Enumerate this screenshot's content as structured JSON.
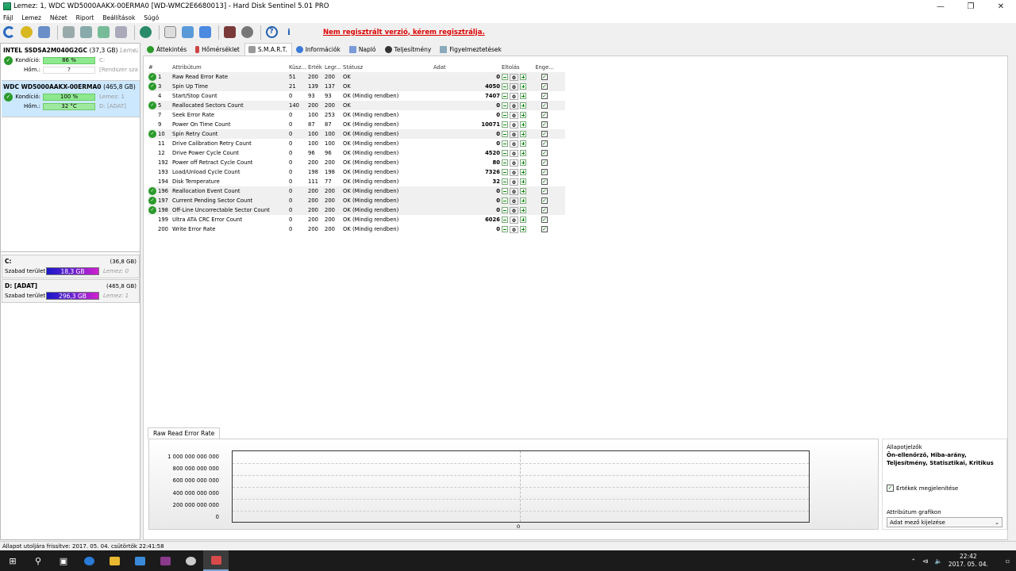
{
  "window": {
    "title": "Lemez: 1, WDC WD5000AAKX-00ERMA0 [WD-WMC2E6680013]  -  Hard Disk Sentinel 5.01 PRO"
  },
  "menu": [
    "Fájl",
    "Lemez",
    "Nézet",
    "Riport",
    "Beállítások",
    "Súgó"
  ],
  "toolbar": {
    "register_msg": "Nem regisztrált verzió, kérem regisztrálja."
  },
  "disks": [
    {
      "name": "INTEL SSDSA2M040G2GC",
      "capacity": "(37,3 GB)",
      "lemez": "Lemez:",
      "cond_label": "Kondíció:",
      "cond": "86 %",
      "cond_pct": 86,
      "cond_extra": "C:",
      "temp_label": "Hőm.:",
      "temp": "?",
      "temp_extra": "[Rendszer sza"
    },
    {
      "name": "WDC WD5000AAKX-00ERMA0",
      "capacity": "(465,8 GB)",
      "lemez": "",
      "cond_label": "Kondíció:",
      "cond": "100 %",
      "cond_pct": 100,
      "cond_extra": "Lemez: 1",
      "temp_label": "Hőm.:",
      "temp": "32 °C",
      "temp_extra": "D: [ADAT]"
    }
  ],
  "volumes": [
    {
      "name": "C:",
      "size": "(36,8 GB)",
      "free_label": "Szabad terület",
      "free": "18,3 GB",
      "lemez": "Lemez: 0"
    },
    {
      "name": "D: [ADAT]",
      "size": "(465,8 GB)",
      "free_label": "Szabad terület",
      "free": "296,3 GB",
      "lemez": "Lemez: 1"
    }
  ],
  "tabs": [
    "Áttekintés",
    "Hőmérséklet",
    "S.M.A.R.T.",
    "Információk",
    "Napló",
    "Teljesítmény",
    "Figyelmeztetések"
  ],
  "smart": {
    "headers": {
      "num": "#",
      "attr": "Attribútum",
      "thr": "Küsz...",
      "val": "Érték",
      "worst": "Legr...",
      "status": "Státusz",
      "data": "Adat",
      "offset": "Eltolás",
      "enable": "Enge..."
    },
    "rows": [
      {
        "id": "1",
        "name": "Raw Read Error Rate",
        "thr": "51",
        "val": "200",
        "worst": "200",
        "status": "OK",
        "data": "0",
        "off": "0",
        "ok": true
      },
      {
        "id": "3",
        "name": "Spin Up Time",
        "thr": "21",
        "val": "139",
        "worst": "137",
        "status": "OK",
        "data": "4050",
        "off": "0",
        "ok": true
      },
      {
        "id": "4",
        "name": "Start/Stop Count",
        "thr": "0",
        "val": "93",
        "worst": "93",
        "status": "OK (Mindig rendben)",
        "data": "7407",
        "off": "0",
        "ok": false
      },
      {
        "id": "5",
        "name": "Reallocated Sectors Count",
        "thr": "140",
        "val": "200",
        "worst": "200",
        "status": "OK",
        "data": "0",
        "off": "0",
        "ok": true
      },
      {
        "id": "7",
        "name": "Seek Error Rate",
        "thr": "0",
        "val": "100",
        "worst": "253",
        "status": "OK (Mindig rendben)",
        "data": "0",
        "off": "0",
        "ok": false
      },
      {
        "id": "9",
        "name": "Power On Time Count",
        "thr": "0",
        "val": "87",
        "worst": "87",
        "status": "OK (Mindig rendben)",
        "data": "10071",
        "off": "0",
        "ok": false
      },
      {
        "id": "10",
        "name": "Spin Retry Count",
        "thr": "0",
        "val": "100",
        "worst": "100",
        "status": "OK (Mindig rendben)",
        "data": "0",
        "off": "0",
        "ok": true
      },
      {
        "id": "11",
        "name": "Drive Calibration Retry Count",
        "thr": "0",
        "val": "100",
        "worst": "100",
        "status": "OK (Mindig rendben)",
        "data": "0",
        "off": "0",
        "ok": false
      },
      {
        "id": "12",
        "name": "Drive Power Cycle Count",
        "thr": "0",
        "val": "96",
        "worst": "96",
        "status": "OK (Mindig rendben)",
        "data": "4520",
        "off": "0",
        "ok": false
      },
      {
        "id": "192",
        "name": "Power off Retract Cycle Count",
        "thr": "0",
        "val": "200",
        "worst": "200",
        "status": "OK (Mindig rendben)",
        "data": "80",
        "off": "0",
        "ok": false
      },
      {
        "id": "193",
        "name": "Load/Unload Cycle Count",
        "thr": "0",
        "val": "198",
        "worst": "198",
        "status": "OK (Mindig rendben)",
        "data": "7326",
        "off": "0",
        "ok": false
      },
      {
        "id": "194",
        "name": "Disk Temperature",
        "thr": "0",
        "val": "111",
        "worst": "77",
        "status": "OK (Mindig rendben)",
        "data": "32",
        "off": "0",
        "ok": false
      },
      {
        "id": "196",
        "name": "Reallocation Event Count",
        "thr": "0",
        "val": "200",
        "worst": "200",
        "status": "OK (Mindig rendben)",
        "data": "0",
        "off": "0",
        "ok": true
      },
      {
        "id": "197",
        "name": "Current Pending Sector Count",
        "thr": "0",
        "val": "200",
        "worst": "200",
        "status": "OK (Mindig rendben)",
        "data": "0",
        "off": "0",
        "ok": true
      },
      {
        "id": "198",
        "name": "Off-Line Uncorrectable Sector Count",
        "thr": "0",
        "val": "200",
        "worst": "200",
        "status": "OK (Mindig rendben)",
        "data": "0",
        "off": "0",
        "ok": true
      },
      {
        "id": "199",
        "name": "Ultra ATA CRC Error Count",
        "thr": "0",
        "val": "200",
        "worst": "200",
        "status": "OK (Mindig rendben)",
        "data": "6026",
        "off": "0",
        "ok": false
      },
      {
        "id": "200",
        "name": "Write Error Rate",
        "thr": "0",
        "val": "200",
        "worst": "200",
        "status": "OK (Mindig rendben)",
        "data": "0",
        "off": "0",
        "ok": false
      }
    ]
  },
  "graph": {
    "tab": "Raw Read Error Rate",
    "yticks": [
      "1 000 000 000 000",
      "800 000 000 000",
      "600 000 000 000",
      "400 000 000 000",
      "200 000 000 000",
      "0"
    ],
    "xlabel": "0"
  },
  "side": {
    "title": "Állapotjelzők",
    "bold": "Ön-ellenőrző, Hiba-arány, Teljesítmény, Statisztikai, Kritikus",
    "checkbox": "Értékek megjelenítése",
    "graph_label": "Attribútum grafikon",
    "graph_select": "Adat mező kijelzése"
  },
  "status": "Állapot utoljára frissítve: 2017. 05. 04. csütörtök 22:41:58",
  "clock": {
    "time": "22:42",
    "date": "2017. 05. 04."
  },
  "colors": {
    "ok_green": "#2a9a2a",
    "register_red": "#dd0000",
    "taskbar": "#1b1b1b"
  }
}
